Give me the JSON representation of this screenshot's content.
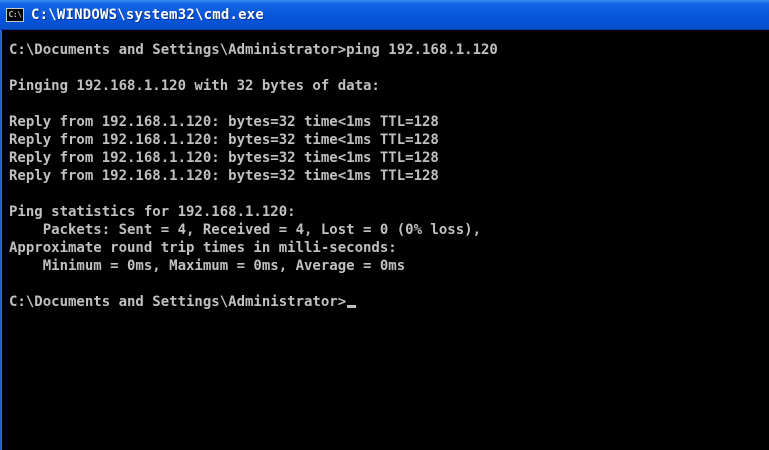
{
  "window": {
    "title": "C:\\WINDOWS\\system32\\cmd.exe",
    "icon_label": "C:\\",
    "icon": "console-icon"
  },
  "console": {
    "prompt_command": "C:\\Documents and Settings\\Administrator>ping 192.168.1.120",
    "pinging_line": "Pinging 192.168.1.120 with 32 bytes of data:",
    "replies": [
      "Reply from 192.168.1.120: bytes=32 time<1ms TTL=128",
      "Reply from 192.168.1.120: bytes=32 time<1ms TTL=128",
      "Reply from 192.168.1.120: bytes=32 time<1ms TTL=128",
      "Reply from 192.168.1.120: bytes=32 time<1ms TTL=128"
    ],
    "stats_header": "Ping statistics for 192.168.1.120:",
    "packets_line": "    Packets: Sent = 4, Received = 4, Lost = 0 (0% loss),",
    "rtt_header": "Approximate round trip times in milli-seconds:",
    "rtt_line": "    Minimum = 0ms, Maximum = 0ms, Average = 0ms",
    "final_prompt": "C:\\Documents and Settings\\Administrator>"
  },
  "colors": {
    "console_background": "#000000",
    "console_text": "#c0c0c0",
    "titlebar": "#0a58dc"
  }
}
